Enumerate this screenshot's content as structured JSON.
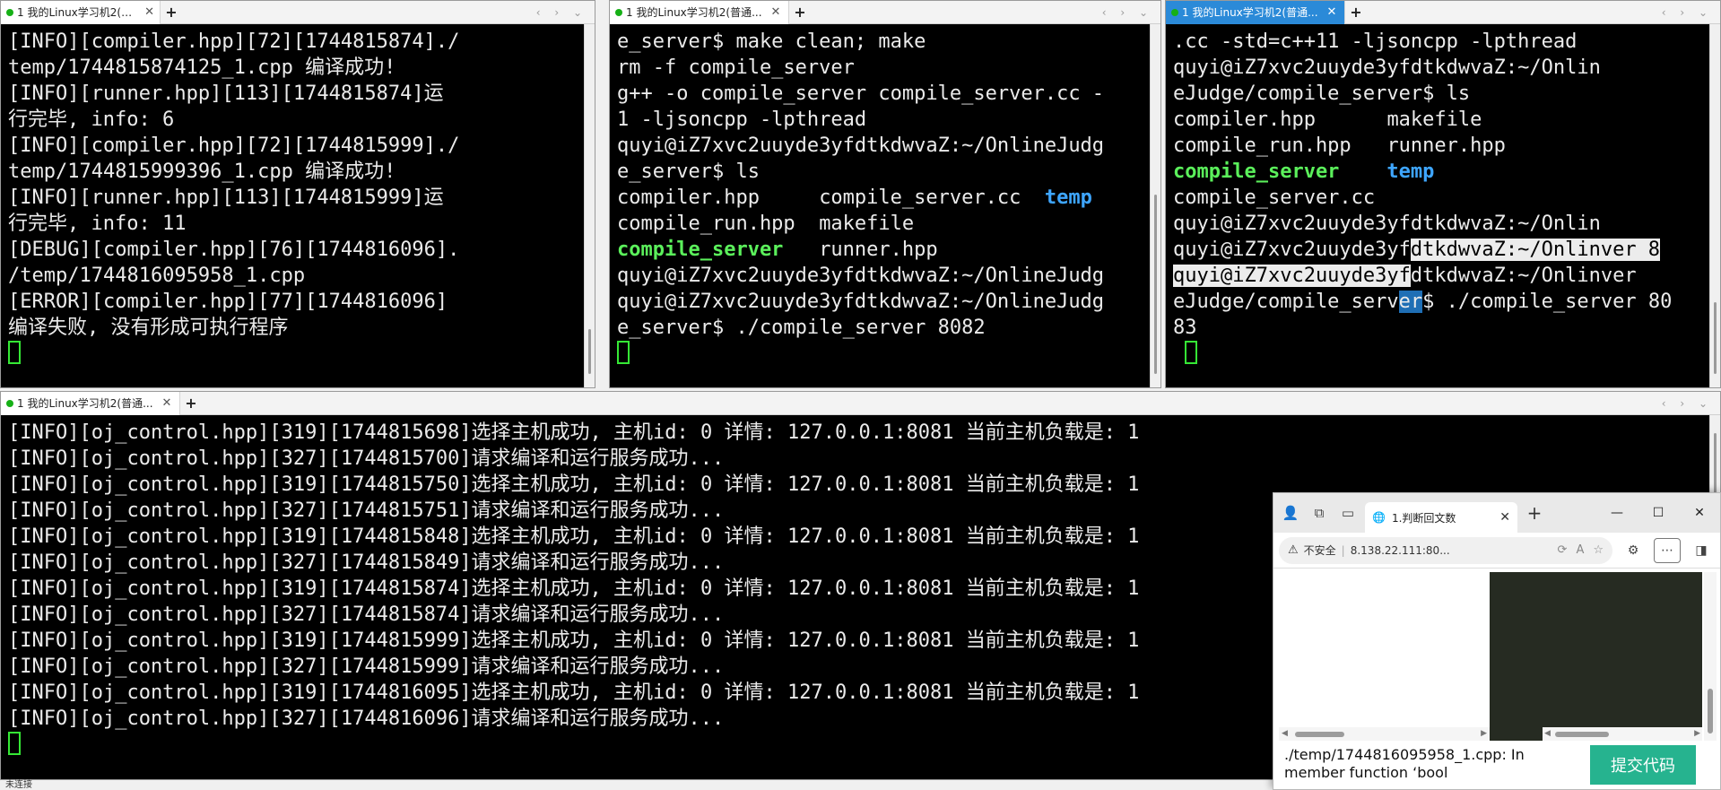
{
  "terminals": [
    {
      "tab_title": "1 我的Linux学习机2(普通...",
      "active": false,
      "lines": [
        "[INFO][compiler.hpp][72][1744815874]./",
        "temp/1744815874125_1.cpp 编译成功!",
        "[INFO][runner.hpp][113][1744815874]运",
        "行完毕, info: 6",
        "[INFO][compiler.hpp][72][1744815999]./",
        "temp/1744815999396_1.cpp 编译成功!",
        "[INFO][runner.hpp][113][1744815999]运",
        "行完毕, info: 11",
        "[DEBUG][compiler.hpp][76][1744816096].",
        "/temp/1744816095958_1.cpp",
        "[ERROR][compiler.hpp][77][1744816096]",
        "编译失败, 没有形成可执行程序"
      ]
    },
    {
      "tab_title": "1 我的Linux学习机2(普通...",
      "active": false,
      "lines": [
        "e_server$ make clean; make",
        "rm -f compile_server",
        "g++ -o compile_server compile_server.cc -",
        "1 -ljsoncpp -lpthread",
        "quyi@iZ7xvc2uuyde3yfdtkdwvaZ:~/OnlineJudg",
        "e_server$ ls"
      ],
      "ls": {
        "row1": [
          "compiler.hpp",
          "compile_server.cc",
          "temp"
        ],
        "row2": [
          "compile_run.hpp",
          "makefile"
        ],
        "row3": [
          "compile_server",
          "runner.hpp"
        ]
      },
      "tail_lines": [
        "quyi@iZ7xvc2uuyde3yfdtkdwvaZ:~/OnlineJudg",
        "quyi@iZ7xvc2uuyde3yfdtkdwvaZ:~/OnlineJudg",
        "e_server$ ./compile_server 8082"
      ]
    },
    {
      "tab_title": "1 我的Linux学习机2(普通...",
      "active": true,
      "lines": [
        ".cc -std=c++11 -ljsoncpp -lpthread",
        "quyi@iZ7xvc2uuyde3yfdtkdwvaZ:~/Onlin",
        "eJudge/compile_server$ ls"
      ],
      "ls": {
        "row1": [
          "compiler.hpp",
          "makefile"
        ],
        "row2": [
          "compile_run.hpp",
          "runner.hpp"
        ],
        "row3": [
          "compile_server",
          "temp"
        ],
        "row4": [
          "compile_server.cc"
        ]
      },
      "tail": {
        "l1": "quyi@iZ7xvc2uuyde3yfdtkdwvaZ:~/Onlin",
        "l2a": "quyi@iZ7xvc2uuyde3yf",
        "l2b": "dtkdwvaZ:~/Onlinver 8",
        "l3a": "quyi@iZ7xvc2uuyde3yf",
        "l3b": "dtkdwvaZ:~/Onlinver",
        "l4a": "eJudge/compile_serv",
        "l4b": "er",
        "l4c": "$ ./compile_server 80",
        "l5": "83"
      }
    },
    {
      "tab_title": "1 我的Linux学习机2(普通...",
      "active": false,
      "lines": [
        "[INFO][oj_control.hpp][319][1744815698]选择主机成功, 主机id: 0 详情: 127.0.0.1:8081 当前主机负载是: 1",
        "[INFO][oj_control.hpp][327][1744815700]请求编译和运行服务成功...",
        "[INFO][oj_control.hpp][319][1744815750]选择主机成功, 主机id: 0 详情: 127.0.0.1:8081 当前主机负载是: 1",
        "[INFO][oj_control.hpp][327][1744815751]请求编译和运行服务成功...",
        "[INFO][oj_control.hpp][319][1744815848]选择主机成功, 主机id: 0 详情: 127.0.0.1:8081 当前主机负载是: 1",
        "[INFO][oj_control.hpp][327][1744815849]请求编译和运行服务成功...",
        "[INFO][oj_control.hpp][319][1744815874]选择主机成功, 主机id: 0 详情: 127.0.0.1:8081 当前主机负载是: 1",
        "[INFO][oj_control.hpp][327][1744815874]请求编译和运行服务成功...",
        "[INFO][oj_control.hpp][319][1744815999]选择主机成功, 主机id: 0 详情: 127.0.0.1:8081 当前主机负载是: 1",
        "[INFO][oj_control.hpp][327][1744815999]请求编译和运行服务成功...",
        "[INFO][oj_control.hpp][319][1744816095]选择主机成功, 主机id: 0 详情: 127.0.0.1:8081 当前主机负载是: 1",
        "[INFO][oj_control.hpp][327][1744816096]请求编译和运行服务成功..."
      ]
    }
  ],
  "browser": {
    "tab_title": "1.判断回文数",
    "insecure_label": "不安全",
    "url": "8.138.22.111:80...",
    "output_lines": [
      "./temp/1744816095958_1.cpp: In",
      "member function ‘bool"
    ],
    "submit_label": "提交代码"
  },
  "statusbar": {
    "text": "未连接"
  },
  "colors": {
    "exec_green": "#5bf05b",
    "dir_blue": "#3ea6ff",
    "active_tab": "#2b8ad8",
    "submit_button": "#26b38f"
  }
}
